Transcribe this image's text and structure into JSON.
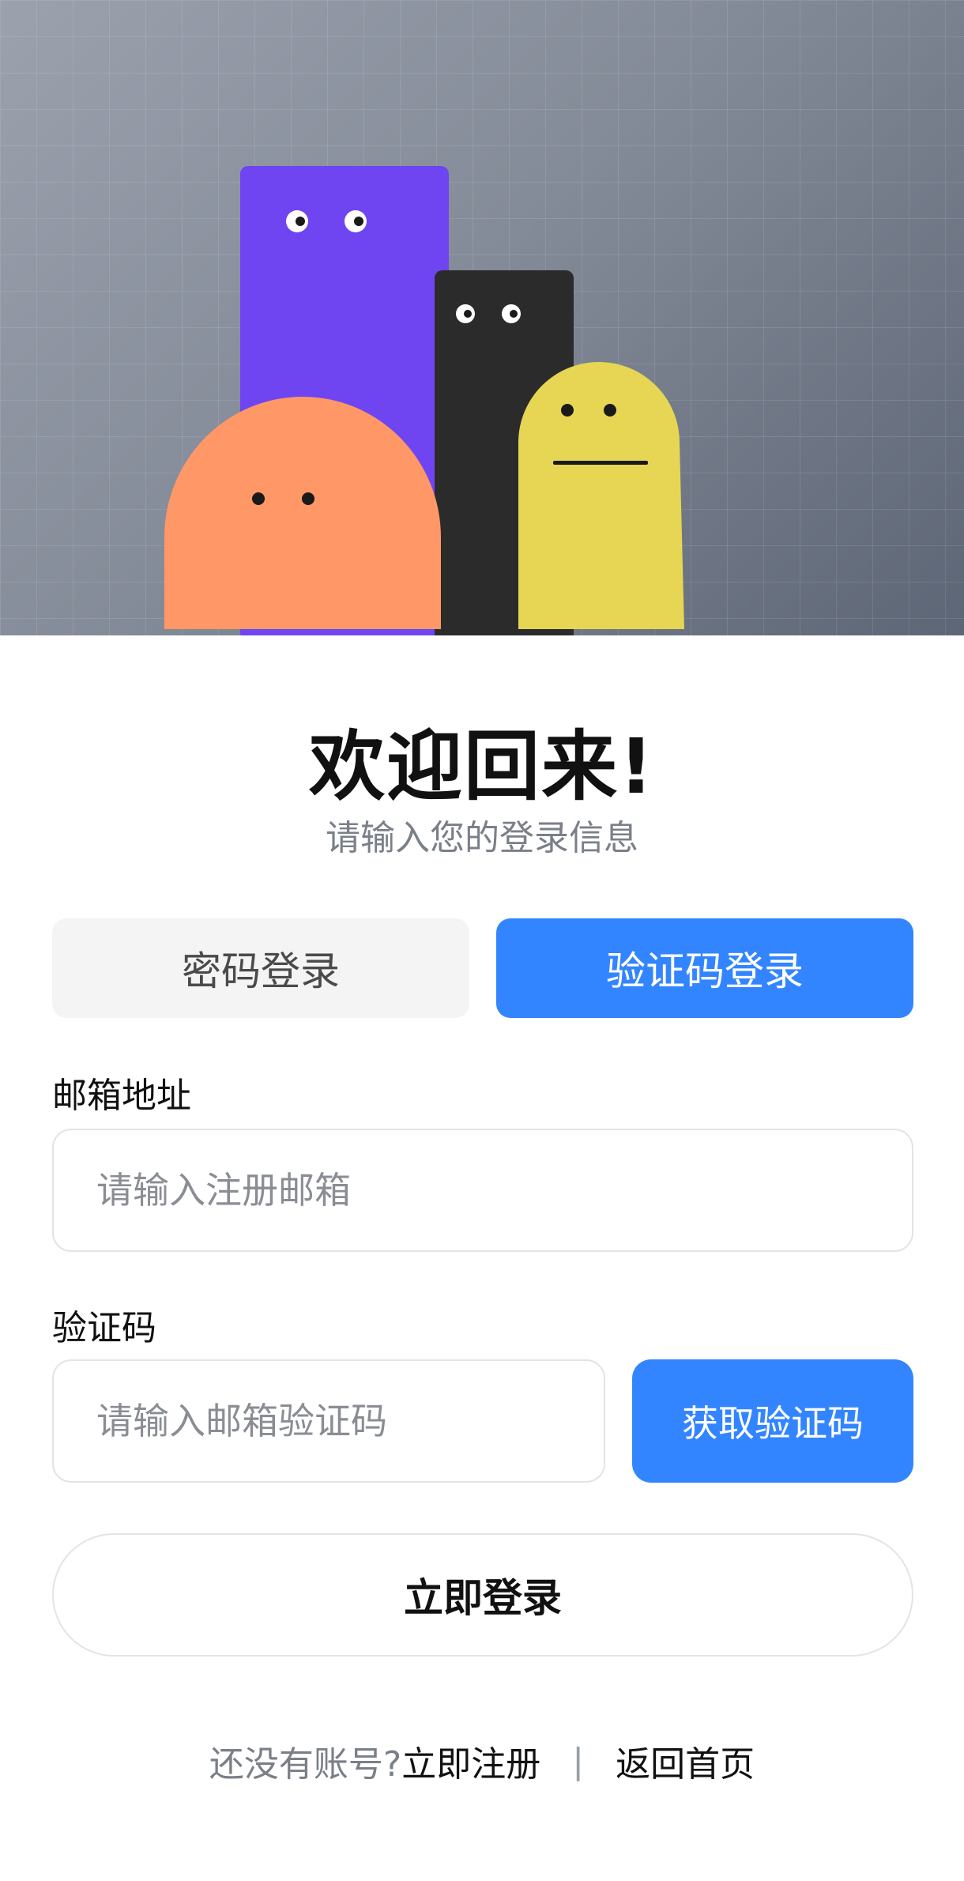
{
  "hero": {
    "colors": {
      "purple": "#6f45f2",
      "black": "#2b2b2b",
      "orange": "#ff9866",
      "yellow": "#e6d654"
    }
  },
  "header": {
    "title": "欢迎回来!",
    "subtitle": "请输入您的登录信息"
  },
  "tabs": [
    {
      "label": "密码登录",
      "active": false
    },
    {
      "label": "验证码登录",
      "active": true
    }
  ],
  "form": {
    "email": {
      "label": "邮箱地址",
      "placeholder": "请输入注册邮箱",
      "value": ""
    },
    "code": {
      "label": "验证码",
      "placeholder": "请输入邮箱验证码",
      "value": ""
    },
    "get_code_label": "获取验证码",
    "submit_label": "立即登录"
  },
  "footer": {
    "prompt": "还没有账号?",
    "register_label": "立即注册",
    "separator": "|",
    "home_label": "返回首页"
  },
  "colors": {
    "accent": "#3385ff",
    "tab_inactive_bg": "#f4f4f5",
    "muted_text": "#7a7f88"
  }
}
